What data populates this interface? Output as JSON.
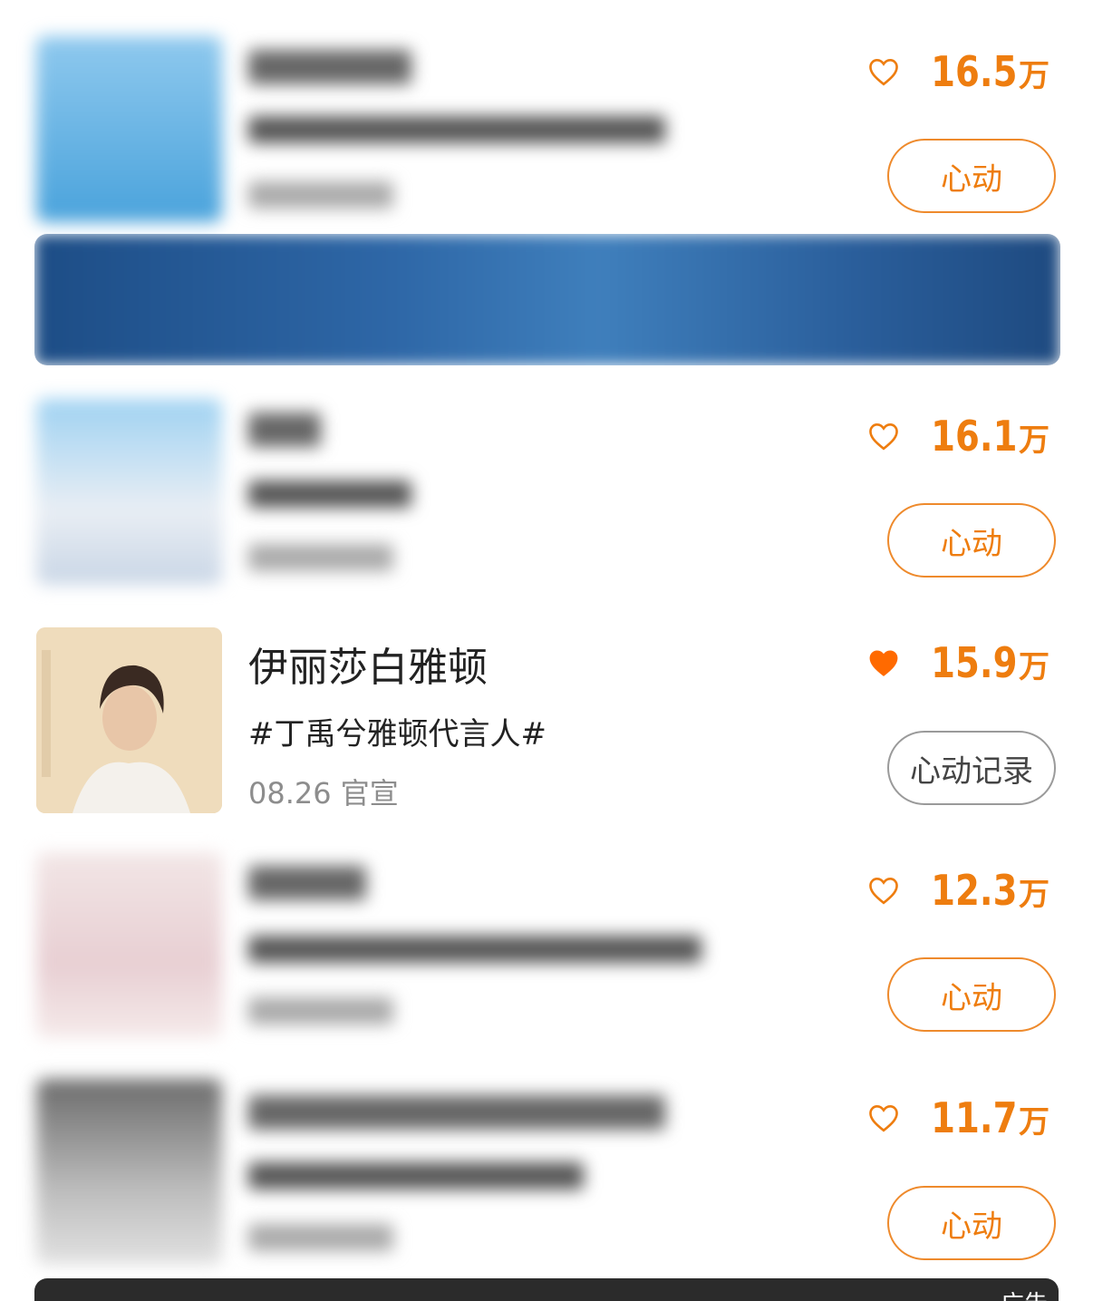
{
  "items": [
    {
      "title": "",
      "tag": "",
      "meta": "",
      "likes": "16.5",
      "unit": "万",
      "liked": false,
      "button": "心动"
    },
    {
      "title": "",
      "tag": "",
      "meta": "",
      "likes": "16.1",
      "unit": "万",
      "liked": false,
      "button": "心动"
    },
    {
      "title": "伊丽莎白雅顿",
      "tag": "#丁禹兮雅顿代言人#",
      "meta": "08.26 官宣",
      "likes": "15.9",
      "unit": "万",
      "liked": true,
      "button": "心动记录"
    },
    {
      "title": "",
      "tag": "",
      "meta": "",
      "likes": "12.3",
      "unit": "万",
      "liked": false,
      "button": "心动"
    },
    {
      "title": "",
      "tag": "",
      "meta": "",
      "likes": "11.7",
      "unit": "万",
      "liked": false,
      "button": "心动"
    }
  ],
  "ad": {
    "label": "广告"
  },
  "colors": {
    "accent": "#ee7d0f",
    "muted": "#8d8d8d",
    "liked_heart": "#ff6a00"
  },
  "icons": {
    "heart_outline": "heart-outline-icon",
    "heart_filled": "heart-filled-icon"
  }
}
